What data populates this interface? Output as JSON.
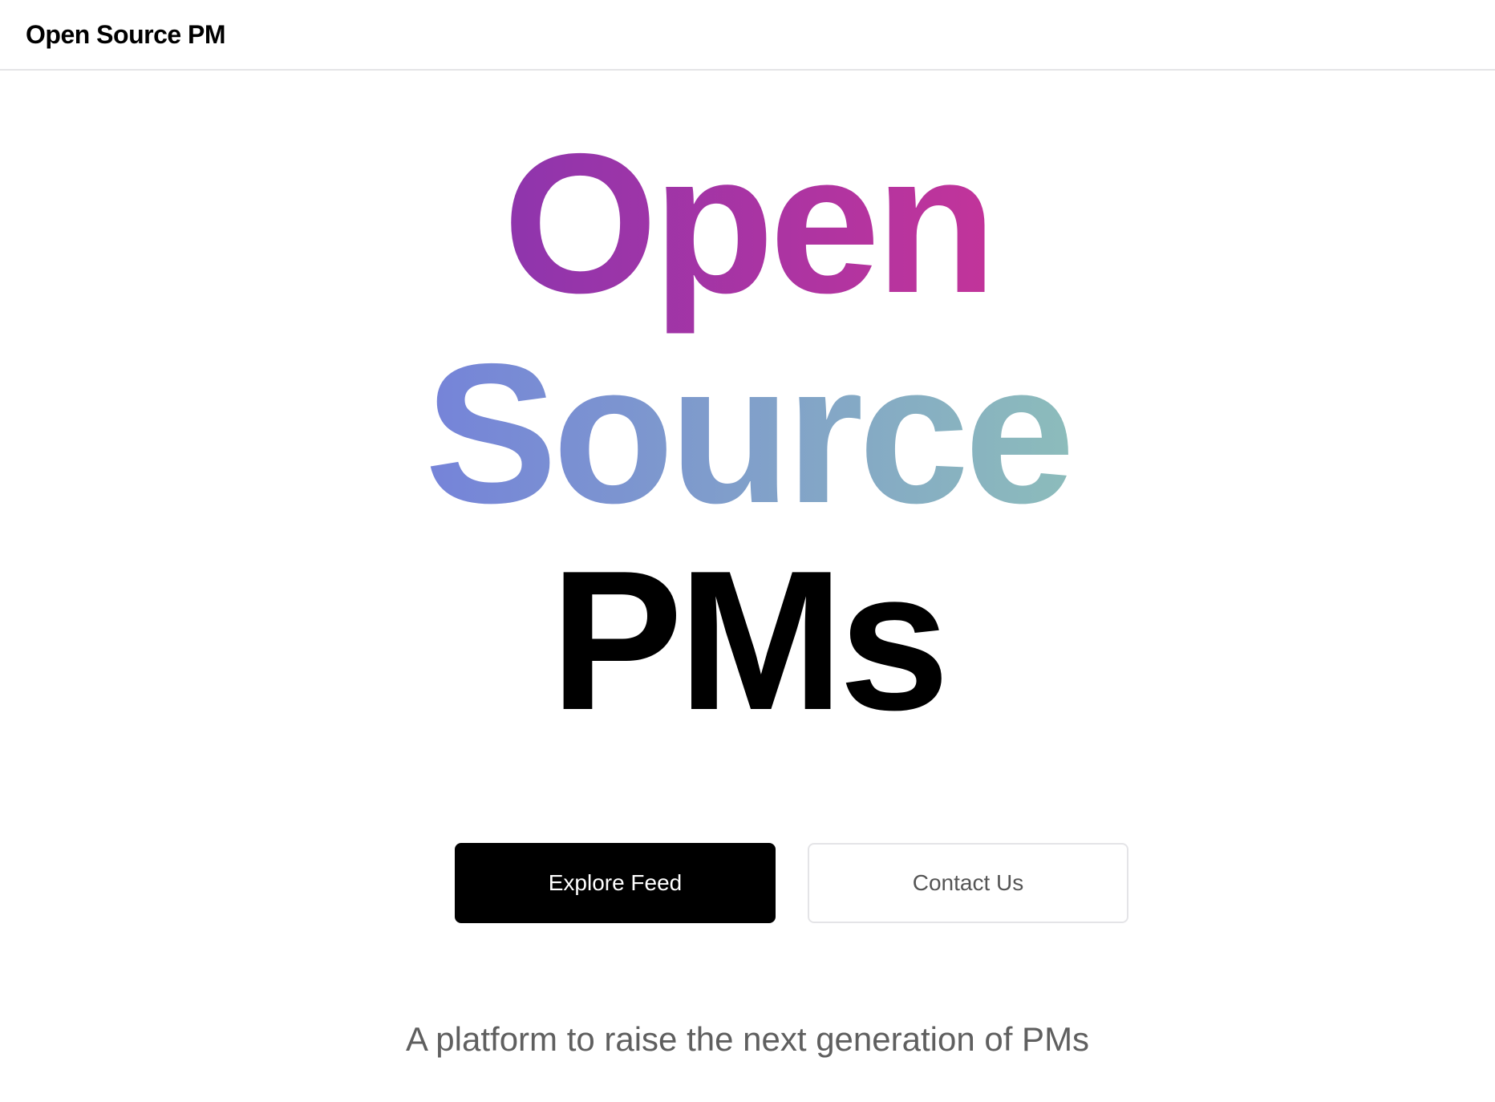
{
  "navbar": {
    "brand": "Open Source PM"
  },
  "hero": {
    "line1": "Open",
    "line2": "Source",
    "line3": "PMs",
    "line1_gradient": [
      "#8e35ad",
      "#c2349a"
    ],
    "line2_gradient": [
      "#7583d9",
      "#8cbcbb"
    ],
    "line3_color": "#000000"
  },
  "actions": {
    "primary_label": "Explore Feed",
    "secondary_label": "Contact Us"
  },
  "tagline": "A platform to raise the next generation of PMs"
}
